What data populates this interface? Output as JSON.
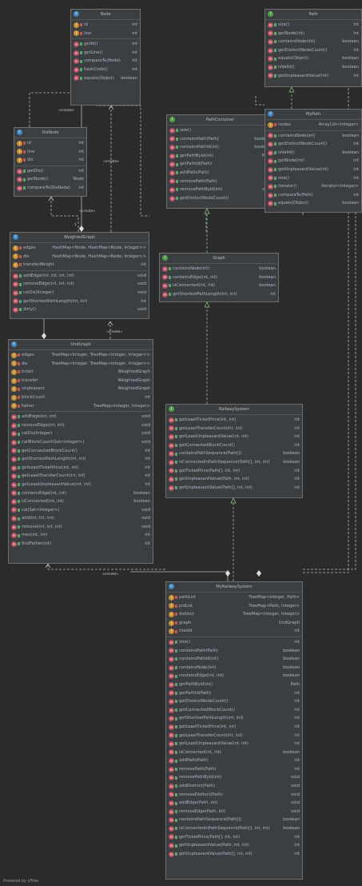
{
  "nodes": [
    {
      "id": "node",
      "kind": "c",
      "title": "Node",
      "fields": [
        [
          "id",
          "int"
        ],
        [
          "line",
          "int"
        ]
      ],
      "methods": [
        [
          "getId()",
          "int"
        ],
        [
          "getLine()",
          "int"
        ],
        [
          "compareTo(Node)",
          "int"
        ],
        [
          "hashCode()",
          "int"
        ],
        [
          "equals(Object)",
          "boolean"
        ]
      ]
    },
    {
      "id": "path",
      "kind": "i",
      "title": "Path",
      "fields": [],
      "methods": [
        [
          "size()",
          "int"
        ],
        [
          "getNode(int)",
          "int"
        ],
        [
          "containsNode(int)",
          "boolean"
        ],
        [
          "getDistinctNodeCount()",
          "int"
        ],
        [
          "equals(Object)",
          "boolean"
        ],
        [
          "isValid()",
          "boolean"
        ],
        [
          "getUnpleasantValue(int)",
          "int"
        ]
      ]
    },
    {
      "id": "dis-node",
      "kind": "c",
      "title": "DisNode",
      "fields": [
        [
          "id",
          "int"
        ],
        [
          "line",
          "int"
        ],
        [
          "dis",
          "int"
        ]
      ],
      "methods": [
        [
          "getDis()",
          "int"
        ],
        [
          "getNode()",
          "Node"
        ],
        [
          "compareTo(DisNode)",
          "int"
        ]
      ]
    },
    {
      "id": "path-container",
      "kind": "i",
      "title": "PathContainer",
      "fields": [],
      "methods": [
        [
          "size()",
          "int"
        ],
        [
          "containsPath(Path)",
          "boolean"
        ],
        [
          "containsPathId(int)",
          "boolean"
        ],
        [
          "getPathById(int)",
          "Path"
        ],
        [
          "getPathId(Path)",
          "int"
        ],
        [
          "addPath(Path)",
          "int"
        ],
        [
          "removePath(Path)",
          "int"
        ],
        [
          "removePathById(int)",
          "void"
        ],
        [
          "getDistinctNodeCount()",
          "int"
        ]
      ]
    },
    {
      "id": "my-path",
      "kind": "c",
      "title": "MyPath",
      "fields": [
        [
          "nodes",
          "ArrayList<Integer>"
        ]
      ],
      "methods": [
        [
          "containsNode(int)",
          "boolean"
        ],
        [
          "getDistinctNodeCount()",
          "int"
        ],
        [
          "isValid()",
          "boolean"
        ],
        [
          "getNode(int)",
          "int"
        ],
        [
          "getUnpleasantValue(int)",
          "int"
        ],
        [
          "size()",
          "int"
        ],
        [
          "iterator()",
          "Iterator<Integer>"
        ],
        [
          "compareTo(Path)",
          "int"
        ],
        [
          "equals(Object)",
          "boolean"
        ]
      ]
    },
    {
      "id": "weighted-graph",
      "kind": "c",
      "title": "WeightedGraph",
      "fields": [
        [
          "edges",
          "HashMap<Node, HashMap<Node, Integer>>"
        ],
        [
          "dis",
          "HashMap<Node, HashMap<Node, Integer>>"
        ],
        [
          "transferWeight",
          "int"
        ]
      ],
      "methods": [
        [
          "addEdge(int, int, int, int)",
          "void"
        ],
        [
          "removeEdge(int, int, int)",
          "void"
        ],
        [
          "calDis(Integer)",
          "void"
        ],
        [
          "getShortestPathLength(int, int)",
          "int"
        ],
        [
          "dirty()",
          "void"
        ]
      ]
    },
    {
      "id": "graph",
      "kind": "i",
      "title": "Graph",
      "fields": [],
      "methods": [
        [
          "containsNode(int)",
          "boolean"
        ],
        [
          "containsEdge(int, int)",
          "boolean"
        ],
        [
          "isConnected(int, int)",
          "boolean"
        ],
        [
          "getShortestPathLength(int, int)",
          "int"
        ]
      ]
    },
    {
      "id": "und-graph",
      "kind": "c",
      "title": "UndGraph",
      "fields": [
        [
          "edges",
          "TreeMap<Integer, TreeMap<Integer, Integer>>"
        ],
        [
          "dis",
          "TreeMap<Integer, TreeMap<Integer, Integer>>"
        ],
        [
          "ticket",
          "WeightedGraph"
        ],
        [
          "transfer",
          "WeightedGraph"
        ],
        [
          "unpleasant",
          "WeightedGraph"
        ],
        [
          "blockCount",
          "int"
        ],
        [
          "father",
          "TreeMap<Integer, Integer>"
        ]
      ],
      "methods": [
        [
          "addEdge(int, int)",
          "void"
        ],
        [
          "removeEdge(int, int)",
          "void"
        ],
        [
          "calDis(Integer)",
          "void"
        ],
        [
          "callBlockCount(Set<Integer>)",
          "void"
        ],
        [
          "getConnectedBlockCount()",
          "int"
        ],
        [
          "getShortestPathLength(int, int)",
          "int"
        ],
        [
          "getLeastTicketPrice(int, int)",
          "int"
        ],
        [
          "getLeastTransferCount(int, int)",
          "int"
        ],
        [
          "getLeastUnpleasantValue(int, int)",
          "int"
        ],
        [
          "containsEdge(int, int)",
          "boolean"
        ],
        [
          "isConnected(int, int)",
          "boolean"
        ],
        [
          "cal(Set<Integer>)",
          "void"
        ],
        [
          "add(int, int, int)",
          "void"
        ],
        [
          "remove(int, int, int)",
          "void"
        ],
        [
          "max(int, int)",
          "int"
        ],
        [
          "findFather(int)",
          "int"
        ]
      ]
    },
    {
      "id": "railway-system",
      "kind": "i",
      "title": "RailwaySystem",
      "fields": [],
      "methods": [
        [
          "getLeastTicketPrice(int, int)",
          "int"
        ],
        [
          "getLeastTransferCount(int, int)",
          "int"
        ],
        [
          "getLeastUnpleasantValue(int, int)",
          "int"
        ],
        [
          "getConnectedBlockCount()",
          "int"
        ],
        [
          "containsPathSequence(Path[])",
          "boolean"
        ],
        [
          "isConnectedInPathSequence(Path[], int, int)",
          "boolean"
        ],
        [
          "getTicketPrice(Path[], int, int)",
          "int"
        ],
        [
          "getUnpleasantValue(Path, int, int)",
          "int"
        ],
        [
          "getUnpleasantValue(Path[], int, int)",
          "int"
        ]
      ]
    },
    {
      "id": "my-railway-system",
      "kind": "c",
      "title": "MyRailwaySystem",
      "fields": [
        [
          "pathList",
          "TreeMap<Integer, Path>"
        ],
        [
          "pidList",
          "TreeMap<Path, Integer>"
        ],
        [
          "distinct",
          "TreeMap<Integer, Integer>"
        ],
        [
          "graph",
          "UndGraph"
        ],
        [
          "maxId",
          "int"
        ]
      ],
      "methods": [
        [
          "size()",
          "int"
        ],
        [
          "containsPath(Path)",
          "boolean"
        ],
        [
          "containsPathId(int)",
          "boolean"
        ],
        [
          "containsNode(int)",
          "boolean"
        ],
        [
          "containsEdge(int, int)",
          "boolean"
        ],
        [
          "getPathById(int)",
          "Path"
        ],
        [
          "getPathId(Path)",
          "int"
        ],
        [
          "getDistinctNodeCount()",
          "int"
        ],
        [
          "getConnectedBlockCount()",
          "int"
        ],
        [
          "getShortestPathLength(int, int)",
          "int"
        ],
        [
          "getLeastTicketPrice(int, int)",
          "int"
        ],
        [
          "getLeastTransferCount(int, int)",
          "int"
        ],
        [
          "getLeastUnpleasantValue(int, int)",
          "int"
        ],
        [
          "isConnected(int, int)",
          "boolean"
        ],
        [
          "addPath(Path)",
          "int"
        ],
        [
          "removePath(Path)",
          "int"
        ],
        [
          "removePathById(int)",
          "void"
        ],
        [
          "addDistinct(Path)",
          "void"
        ],
        [
          "removeDistinct(Path)",
          "void"
        ],
        [
          "addEdge(Path, int)",
          "void"
        ],
        [
          "removeEdge(Path, int)",
          "void"
        ],
        [
          "containsPathSequence(Path[])",
          "boolean"
        ],
        [
          "isConnectedInPathSequence(Path[], int, int)",
          "boolean"
        ],
        [
          "getTicketPrice(Path[], int, int)",
          "int"
        ],
        [
          "getUnpleasantValue(Path, int, int)",
          "int"
        ],
        [
          "getUnpleasantValue(Path[], int, int)",
          "int"
        ]
      ]
    }
  ],
  "labels": {
    "create": "«create»",
    "one": "1"
  },
  "footer": "Powered by yFiles",
  "colors": {
    "class_badge": "#3d87c7",
    "interface_badge": "#52a04a",
    "field_icon": "#c98f31",
    "method_icon": "#b74a5e",
    "realization_edge": "#8fbc8f",
    "dependency_edge": "#bbbbbb"
  }
}
